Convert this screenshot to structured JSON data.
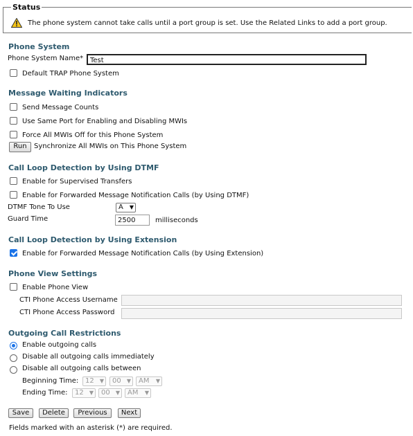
{
  "status": {
    "legend": "Status",
    "message": "The phone system cannot take calls until a port group is set. Use the Related Links to add a port group."
  },
  "phone_system": {
    "title": "Phone System",
    "name_label": "Phone System Name*",
    "name_value": "Test",
    "default_trap_label": "Default TRAP Phone System"
  },
  "mwi": {
    "title": "Message Waiting Indicators",
    "send_counts_label": "Send Message Counts",
    "same_port_label": "Use Same Port for Enabling and Disabling MWIs",
    "force_off_label": "Force All MWIs Off for this Phone System",
    "run_button": "Run",
    "sync_label": "Synchronize All MWIs on This Phone System"
  },
  "dtmf": {
    "title": "Call Loop Detection by Using DTMF",
    "supervised_label": "Enable for Supervised Transfers",
    "forwarded_label": "Enable for Forwarded Message Notification Calls (by Using DTMF)",
    "tone_label": "DTMF Tone To Use",
    "tone_value": "A",
    "guard_label": "Guard Time",
    "guard_value": "2500",
    "guard_unit": "milliseconds"
  },
  "extension": {
    "title": "Call Loop Detection by Using Extension",
    "forwarded_label": "Enable for Forwarded Message Notification Calls (by Using Extension)"
  },
  "phone_view": {
    "title": "Phone View Settings",
    "enable_label": "Enable Phone View",
    "username_label": "CTI Phone Access Username",
    "password_label": "CTI Phone Access Password"
  },
  "outgoing": {
    "title": "Outgoing Call Restrictions",
    "enable_label": "Enable outgoing calls",
    "disable_now_label": "Disable all outgoing calls immediately",
    "disable_between_label": "Disable all outgoing calls between",
    "begin_label": "Beginning Time:",
    "end_label": "Ending Time:",
    "begin_hour": "12",
    "begin_min": "00",
    "begin_ampm": "AM",
    "end_hour": "12",
    "end_min": "00",
    "end_ampm": "AM"
  },
  "buttons": {
    "save": "Save",
    "delete": "Delete",
    "previous": "Previous",
    "next": "Next"
  },
  "footer_note": "Fields marked with an asterisk (*) are required.",
  "colors": {
    "section_title": "#2e5a6e",
    "checkbox_checked": "#1a73e8",
    "warning_fill": "#f5c518"
  }
}
